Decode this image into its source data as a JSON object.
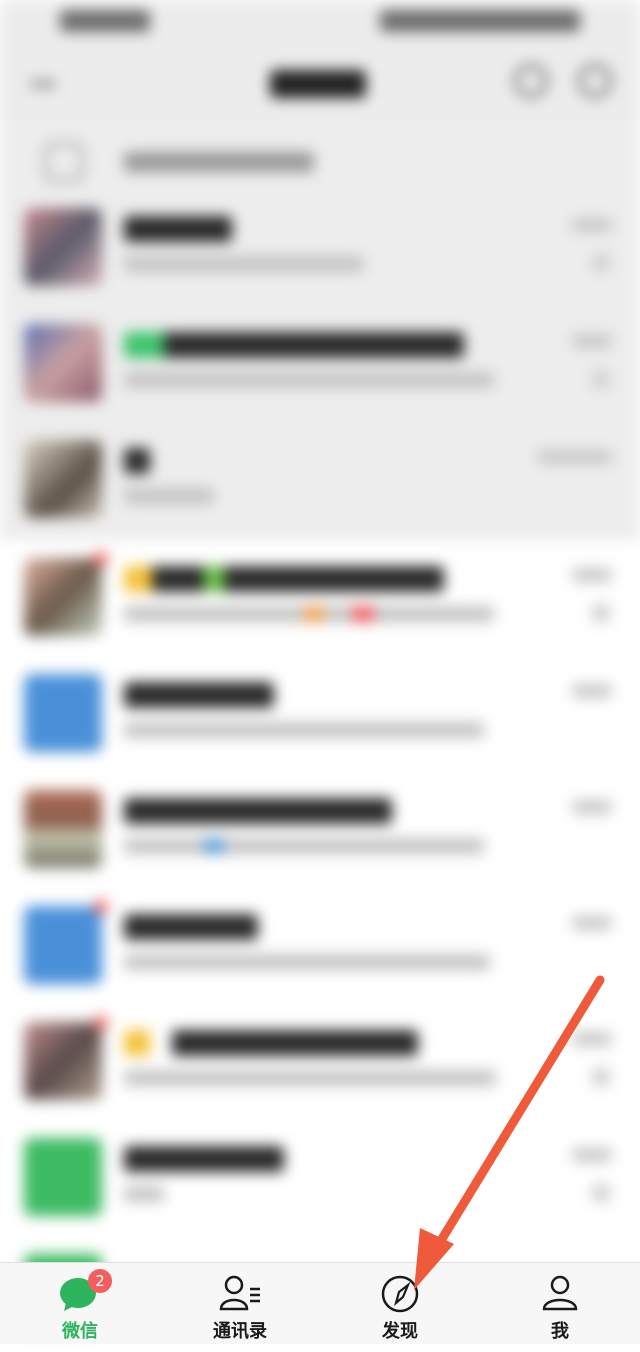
{
  "tabs": [
    {
      "label": "微信",
      "icon": "chat-bubble-icon",
      "active": true,
      "badge": "2"
    },
    {
      "label": "通讯录",
      "icon": "contacts-icon",
      "active": false
    },
    {
      "label": "发现",
      "icon": "compass-icon",
      "active": false
    },
    {
      "label": "我",
      "icon": "person-icon",
      "active": false
    }
  ],
  "colors": {
    "accent": "#2db45c",
    "badge": "#f45e5e",
    "arrow": "#ee5a3a"
  }
}
